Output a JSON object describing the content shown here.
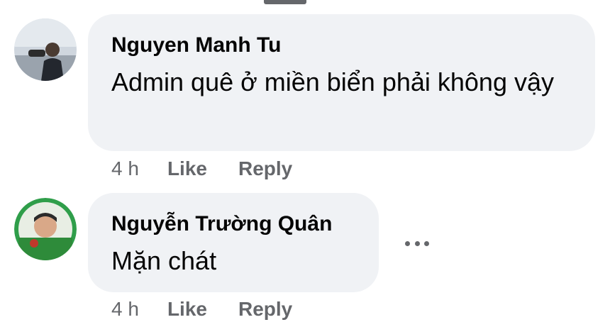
{
  "comments": [
    {
      "author": "Nguyen Manh Tu",
      "text": "Admin quê ở miền biển phải không vậy",
      "time": "4 h",
      "like_label": "Like",
      "reply_label": "Reply",
      "avatar_icon": "user-photo-avatar"
    },
    {
      "author": "Nguyễn Trường Quân",
      "text": "Mặn chát",
      "time": "4 h",
      "like_label": "Like",
      "reply_label": "Reply",
      "avatar_icon": "user-photo-avatar",
      "more_icon": "more-options-icon"
    }
  ],
  "colors": {
    "bubble": "#f0f2f5",
    "text": "#050505",
    "secondary": "#65676b"
  }
}
